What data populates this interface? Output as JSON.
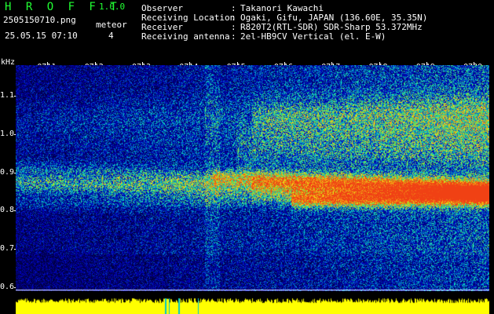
{
  "header": {
    "app_name": "H R O F F T",
    "version": "1.0.0",
    "filename": "2505150710.png",
    "meteor_label": "meteor",
    "datetime": "25.05.15 07:10",
    "meteor_count": "4",
    "info": [
      {
        "label": "Observer",
        "value": "Takanori Kawachi"
      },
      {
        "label": "Receiving Location",
        "value": "Ogaki, Gifu, JAPAN (136.60E, 35.35N)"
      },
      {
        "label": "Receiver",
        "value": "R820T2(RTL-SDR) SDR-Sharp 53.372MHz"
      },
      {
        "label": "Receiving antenna",
        "value": "2el-HB9CV Vertical (el. E-W)"
      }
    ],
    "separator": ":"
  },
  "axes": {
    "y_unit": "kHz",
    "y_ticks": [
      "1.1",
      "1.0",
      "0.9",
      "0.8",
      "0.7",
      "0.6"
    ],
    "y_values": [
      1.1,
      1.0,
      0.9,
      0.8,
      0.7,
      0.6
    ],
    "y_range": [
      0.59,
      1.18
    ],
    "x_ticks": [
      "0711",
      "0712",
      "0713",
      "0714",
      "0715",
      "0716",
      "0717",
      "0718",
      "0719",
      "0720"
    ],
    "x_minutes": [
      11,
      12,
      13,
      14,
      15,
      16,
      17,
      18,
      19,
      20
    ],
    "x_range_minutes": [
      10.33,
      20.33
    ]
  },
  "colors": {
    "header_text": "#21ff33",
    "info_text": "#ffffff",
    "level_bar": "#ffff00",
    "background": "#000000"
  }
}
